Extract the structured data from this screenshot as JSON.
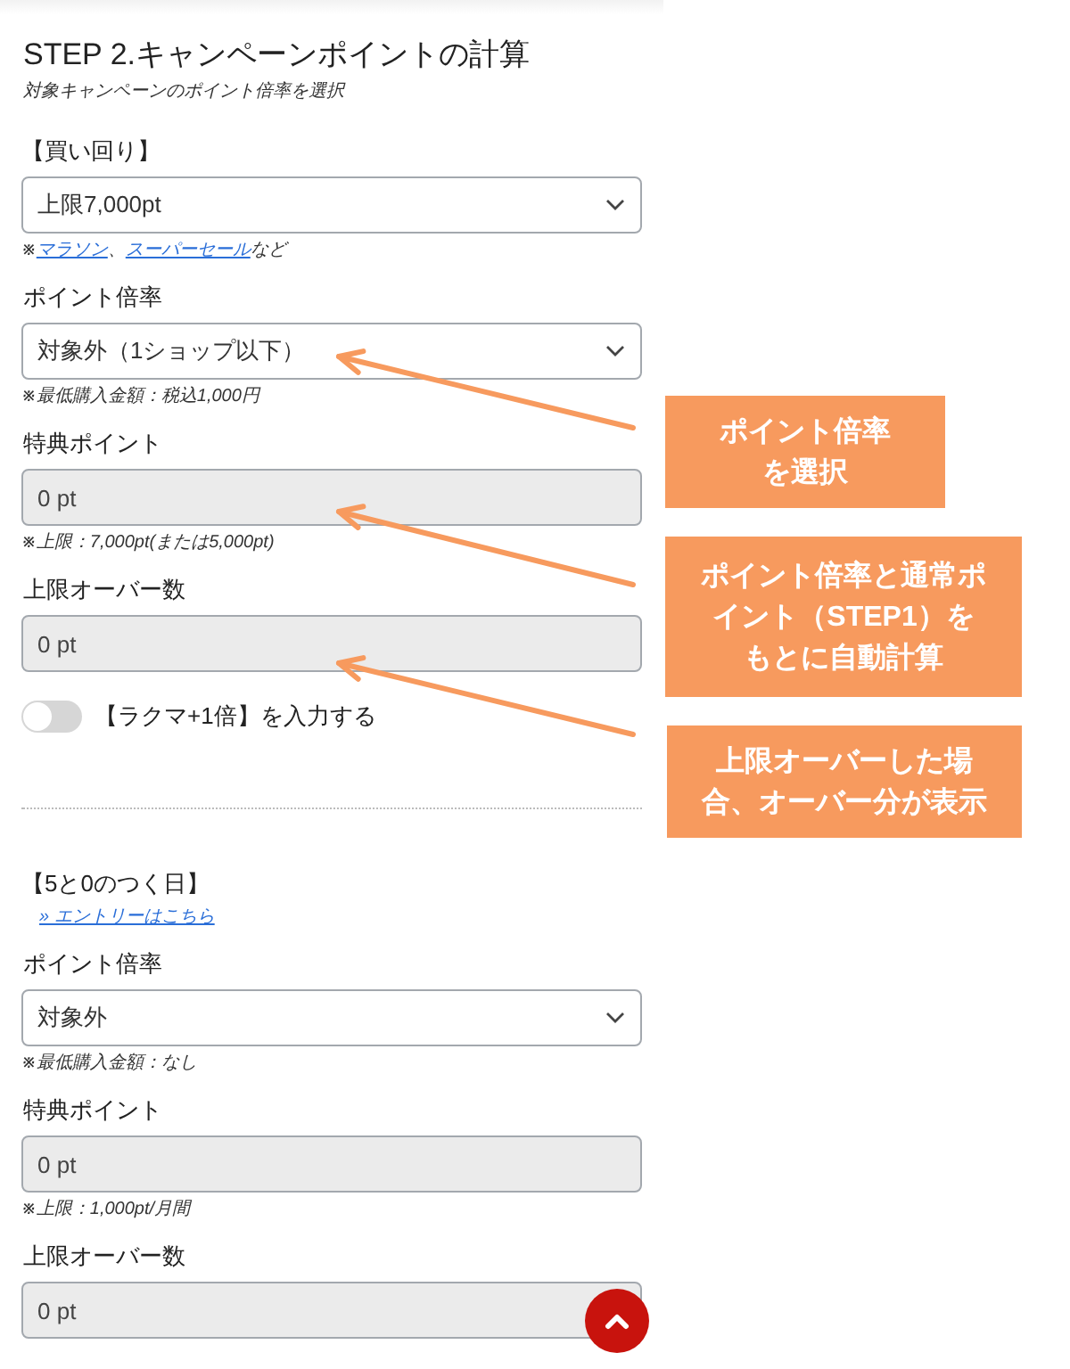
{
  "header": {
    "title": "STEP 2.キャンペーンポイントの計算",
    "subtitle": "対象キャンペーンのポイント倍率を選択"
  },
  "sections": [
    {
      "heading": "【買い回り】",
      "rows": [
        {
          "kind": "select",
          "value": "上限7,000pt"
        },
        {
          "kind": "note",
          "parts": [
            {
              "text": "※",
              "link": false
            },
            {
              "text": "マラソン",
              "link": true
            },
            {
              "text": "、",
              "link": false
            },
            {
              "text": "スーパーセール",
              "link": true
            },
            {
              "text": "など",
              "link": false
            }
          ]
        },
        {
          "kind": "label",
          "text": "ポイント倍率"
        },
        {
          "kind": "select",
          "value": "対象外（1ショップ以下）"
        },
        {
          "kind": "note",
          "parts": [
            {
              "text": "※最低購入金額：税込1,000円",
              "link": false
            }
          ]
        },
        {
          "kind": "label",
          "text": "特典ポイント"
        },
        {
          "kind": "field",
          "value": "0 pt"
        },
        {
          "kind": "note",
          "parts": [
            {
              "text": "※上限：7,000pt(または5,000pt)",
              "link": false
            }
          ]
        },
        {
          "kind": "label",
          "text": "上限オーバー数"
        },
        {
          "kind": "field",
          "value": "0 pt"
        },
        {
          "kind": "toggle",
          "on": false,
          "text": "【ラクマ+1倍】を入力する"
        }
      ]
    },
    {
      "heading": "【5と0のつく日】",
      "rows": [
        {
          "kind": "link",
          "text": "» エントリーはこちら"
        },
        {
          "kind": "label",
          "text": "ポイント倍率"
        },
        {
          "kind": "select",
          "value": "対象外"
        },
        {
          "kind": "note",
          "parts": [
            {
              "text": "※最低購入金額：なし",
              "link": false
            }
          ]
        },
        {
          "kind": "label",
          "text": "特典ポイント"
        },
        {
          "kind": "field",
          "value": "0 pt"
        },
        {
          "kind": "note",
          "parts": [
            {
              "text": "※上限：1,000pt/月間",
              "link": false
            }
          ]
        },
        {
          "kind": "label",
          "text": "上限オーバー数"
        },
        {
          "kind": "field",
          "value": "0 pt"
        }
      ]
    }
  ],
  "callouts": [
    {
      "lines": [
        "ポイント倍率",
        "を選択"
      ]
    },
    {
      "lines": [
        "ポイント倍率と通常ポ",
        "イント（STEP1）を",
        "もとに自動計算"
      ]
    },
    {
      "lines": [
        "上限オーバーした場",
        "合、オーバー分が表示"
      ]
    }
  ]
}
